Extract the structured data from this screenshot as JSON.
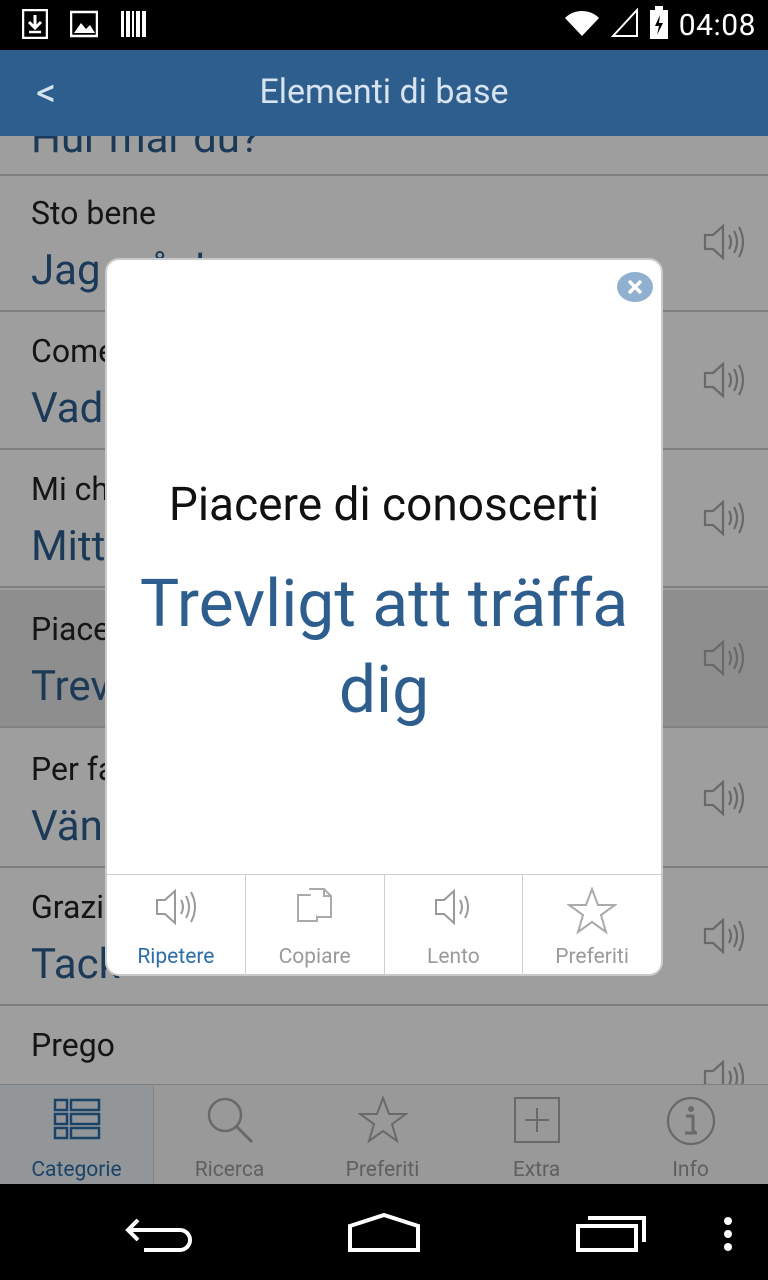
{
  "status_bar": {
    "time": "04:08"
  },
  "header": {
    "back_label": "<",
    "title": "Elementi di base"
  },
  "list": {
    "partial_top": "Hur mår du?",
    "rows": [
      {
        "italian": "Sto bene",
        "swedish": "Jag mår bra"
      },
      {
        "italian": "Come ti chiami?",
        "swedish": "Vad heter du?"
      },
      {
        "italian": "Mi chiamo...",
        "swedish": "Mitt namn är..."
      },
      {
        "italian": "Piacere di conoscerti",
        "swedish": "Trevligt att träffa dig"
      },
      {
        "italian": "Per favore",
        "swedish": "Vänligen"
      },
      {
        "italian": "Grazie",
        "swedish": "Tack"
      },
      {
        "italian": "Prego",
        "swedish": ""
      }
    ]
  },
  "dialog": {
    "italian": "Piacere di conoscerti",
    "swedish": "Trevligt att träffa dig",
    "actions": [
      {
        "label": "Ripetere",
        "icon": "speaker-icon"
      },
      {
        "label": "Copiare",
        "icon": "copy-icon"
      },
      {
        "label": "Lento",
        "icon": "speaker-icon"
      },
      {
        "label": "Preferiti",
        "icon": "star-icon"
      }
    ]
  },
  "tabs": [
    {
      "label": "Categorie",
      "icon": "list-icon",
      "active": true
    },
    {
      "label": "Ricerca",
      "icon": "search-icon"
    },
    {
      "label": "Preferiti",
      "icon": "star-icon"
    },
    {
      "label": "Extra",
      "icon": "plus-box-icon"
    },
    {
      "label": "Info",
      "icon": "info-icon"
    }
  ],
  "colors": {
    "header": "#2d5e8e",
    "accent": "#2d6da8",
    "swedish_text": "#2d5e8e"
  }
}
